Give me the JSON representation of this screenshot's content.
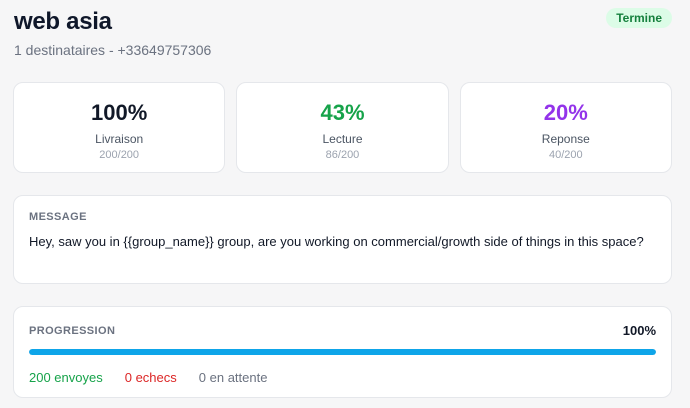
{
  "header": {
    "title": "web asia",
    "subtitle": "1 destinataires - +33649757306",
    "status_badge": "Termine"
  },
  "stats": [
    {
      "value": "100%",
      "label": "Livraison",
      "sub": "200/200",
      "color": "#111827"
    },
    {
      "value": "43%",
      "label": "Lecture",
      "sub": "86/200",
      "color": "#16a34a"
    },
    {
      "value": "20%",
      "label": "Reponse",
      "sub": "40/200",
      "color": "#9333ea"
    }
  ],
  "message": {
    "title": "MESSAGE",
    "text": "Hey, saw you in {{group_name}} group, are you working on commercial/growth side of things in this space?"
  },
  "progress": {
    "title": "PROGRESSION",
    "percent_label": "100%",
    "fraction": 1.0,
    "bar_color": "#0ea5e9",
    "sent": {
      "label": "200 envoyes",
      "color": "#16a34a"
    },
    "failed": {
      "label": "0 echecs",
      "color": "#dc2626"
    },
    "pending": {
      "label": "0 en attente",
      "color": "#6b7280"
    }
  }
}
